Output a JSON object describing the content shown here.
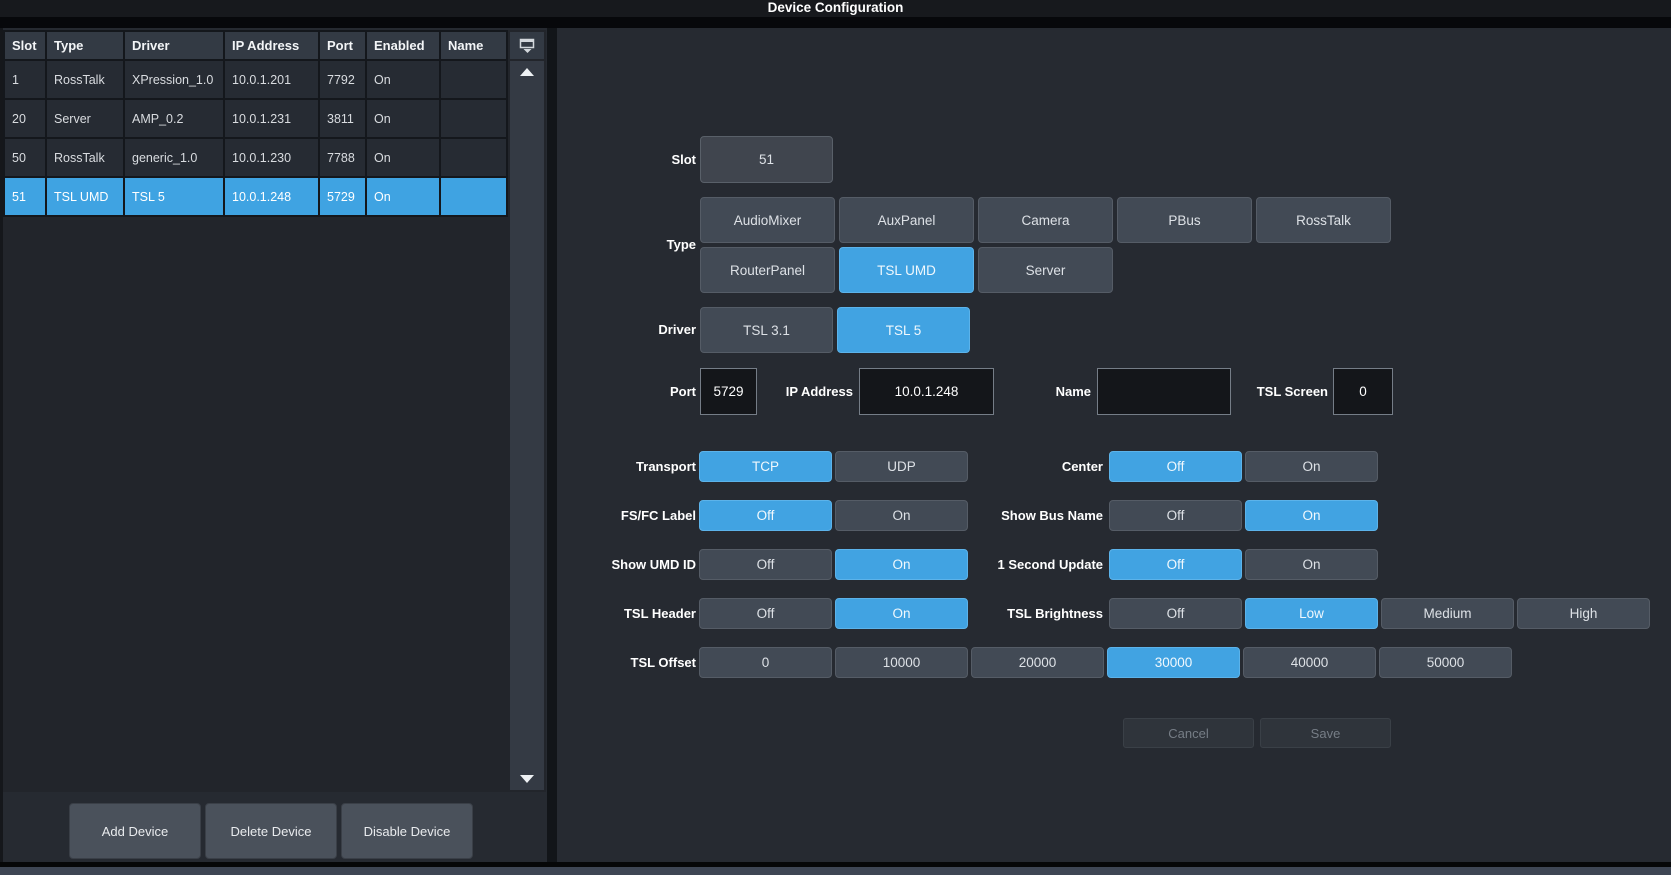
{
  "title": "Device Configuration",
  "colors": {
    "accent": "#3fa3e2",
    "panel_background": "#262a31",
    "button_background": "#424a55",
    "input_background": "#14161a",
    "bottom_bar": "#3e4654"
  },
  "icons": {
    "table_header": "column-settings-icon",
    "scroll_up": "scroll-up-arrow-icon",
    "scroll_down": "scroll-down-arrow-icon"
  },
  "device_table": {
    "columns": [
      "Slot",
      "Type",
      "Driver",
      "IP Address",
      "Port",
      "Enabled",
      "Name"
    ],
    "rows": [
      {
        "slot": "1",
        "type": "RossTalk",
        "driver": "XPression_1.0",
        "ip_address": "10.0.1.201",
        "port": "7792",
        "enabled": "On",
        "name": "",
        "selected": false
      },
      {
        "slot": "20",
        "type": "Server",
        "driver": "AMP_0.2",
        "ip_address": "10.0.1.231",
        "port": "3811",
        "enabled": "On",
        "name": "",
        "selected": false
      },
      {
        "slot": "50",
        "type": "RossTalk",
        "driver": "generic_1.0",
        "ip_address": "10.0.1.230",
        "port": "7788",
        "enabled": "On",
        "name": "",
        "selected": false
      },
      {
        "slot": "51",
        "type": "TSL UMD",
        "driver": "TSL 5",
        "ip_address": "10.0.1.248",
        "port": "5729",
        "enabled": "On",
        "name": "",
        "selected": true
      }
    ]
  },
  "table_actions": [
    {
      "label": "Add Device"
    },
    {
      "label": "Delete Device"
    },
    {
      "label": "Disable Device"
    }
  ],
  "form": {
    "slot": {
      "label": "Slot",
      "value": "51"
    },
    "type": {
      "label": "Type",
      "options": [
        "AudioMixer",
        "AuxPanel",
        "Camera",
        "PBus",
        "RossTalk",
        "RouterPanel",
        "TSL UMD",
        "Server"
      ],
      "selected": "TSL UMD"
    },
    "driver": {
      "label": "Driver",
      "options": [
        "TSL 3.1",
        "TSL 5"
      ],
      "selected": "TSL 5"
    },
    "port": {
      "label": "Port",
      "value": "5729"
    },
    "ip_address": {
      "label": "IP Address",
      "value": "10.0.1.248"
    },
    "name": {
      "label": "Name",
      "value": ""
    },
    "tsl_screen": {
      "label": "TSL Screen",
      "value": "0"
    },
    "toggles_left": [
      {
        "label": "Transport",
        "options": [
          "TCP",
          "UDP"
        ],
        "selected": "TCP"
      },
      {
        "label": "FS/FC Label",
        "options": [
          "Off",
          "On"
        ],
        "selected": "Off"
      },
      {
        "label": "Show UMD ID",
        "options": [
          "Off",
          "On"
        ],
        "selected": "On"
      },
      {
        "label": "TSL Header",
        "options": [
          "Off",
          "On"
        ],
        "selected": "On"
      }
    ],
    "toggles_right": [
      {
        "label": "Center",
        "options": [
          "Off",
          "On"
        ],
        "selected": "Off"
      },
      {
        "label": "Show Bus Name",
        "options": [
          "Off",
          "On"
        ],
        "selected": "On"
      },
      {
        "label": "1 Second Update",
        "options": [
          "Off",
          "On"
        ],
        "selected": "Off"
      },
      {
        "label": "TSL Brightness",
        "options": [
          "Off",
          "Low",
          "Medium",
          "High"
        ],
        "selected": "Low"
      }
    ],
    "tsl_offset": {
      "label": "TSL Offset",
      "options": [
        "0",
        "10000",
        "20000",
        "30000",
        "40000",
        "50000"
      ],
      "selected": "30000"
    },
    "cancel_label": "Cancel",
    "save_label": "Save"
  }
}
